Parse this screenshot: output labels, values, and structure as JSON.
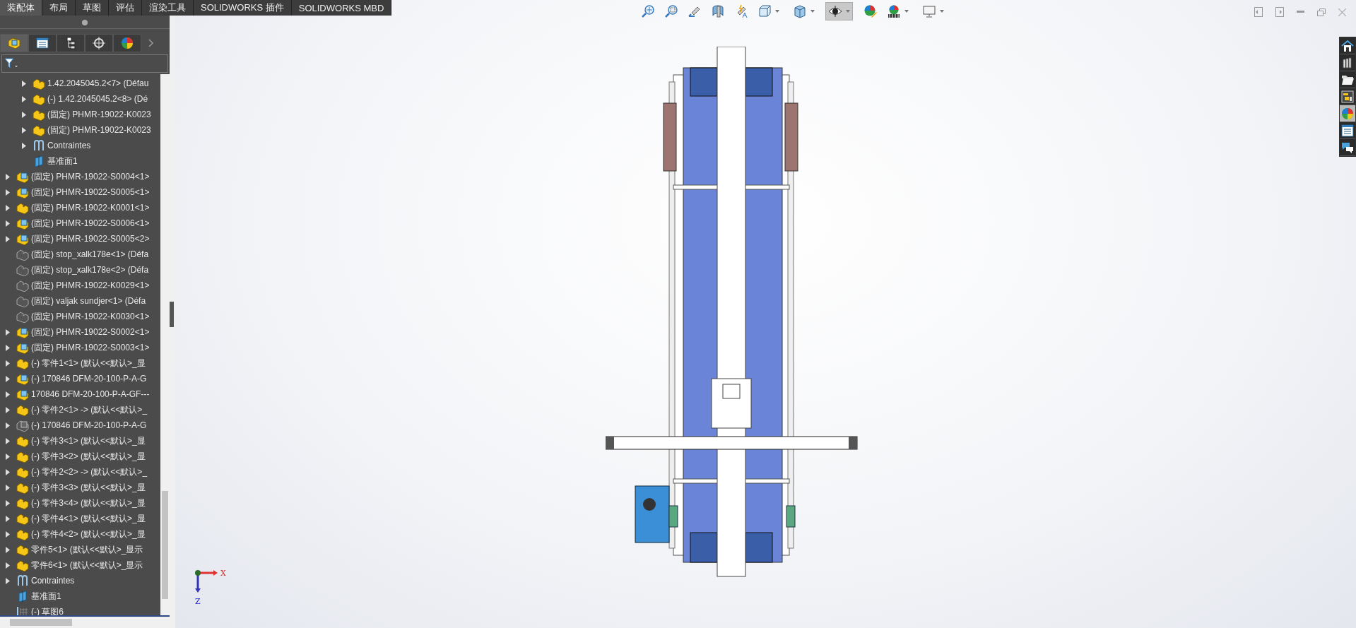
{
  "command_tabs": [
    {
      "label": "装配体",
      "selected": true
    },
    {
      "label": "布局",
      "selected": false
    },
    {
      "label": "草图",
      "selected": false
    },
    {
      "label": "评估",
      "selected": false
    },
    {
      "label": "渲染工具",
      "selected": false
    },
    {
      "label": "SOLIDWORKS 插件",
      "selected": false
    },
    {
      "label": "SOLIDWORKS MBD",
      "selected": false
    }
  ],
  "panel_tabs": [
    {
      "kind": "feature-tree",
      "selected": true
    },
    {
      "kind": "property",
      "selected": false
    },
    {
      "kind": "config",
      "selected": false
    },
    {
      "kind": "dimxpert",
      "selected": false
    },
    {
      "kind": "display",
      "selected": false
    }
  ],
  "tree": {
    "partial_children": [
      {
        "kind": "part",
        "label": "1.42.2045045.2<7> (Défau",
        "expandable": true
      },
      {
        "kind": "part",
        "label": "(-) 1.42.2045045.2<8> (Dé",
        "expandable": true
      },
      {
        "kind": "part",
        "label": "(固定) PHMR-19022-K0023",
        "expandable": true
      },
      {
        "kind": "part",
        "label": "(固定) PHMR-19022-K0023",
        "expandable": true
      },
      {
        "kind": "mates",
        "label": "Contraintes",
        "expandable": true
      },
      {
        "kind": "plane",
        "label": "基准面1",
        "expandable": false
      }
    ],
    "items": [
      {
        "kind": "assembly",
        "label": "(固定) PHMR-19022-S0004<1>",
        "expandable": true
      },
      {
        "kind": "assembly",
        "label": "(固定) PHMR-19022-S0005<1>",
        "expandable": true
      },
      {
        "kind": "part",
        "label": "(固定) PHMR-19022-K0001<1>",
        "expandable": true
      },
      {
        "kind": "assembly",
        "label": "(固定) PHMR-19022-S0006<1>",
        "expandable": true
      },
      {
        "kind": "assembly",
        "label": "(固定) PHMR-19022-S0005<2>",
        "expandable": true
      },
      {
        "kind": "suppressed-part",
        "label": "(固定) stop_xalk178e<1> (Défa",
        "expandable": false
      },
      {
        "kind": "suppressed-part",
        "label": "(固定) stop_xalk178e<2> (Défa",
        "expandable": false
      },
      {
        "kind": "suppressed-part",
        "label": "(固定) PHMR-19022-K0029<1>",
        "expandable": false
      },
      {
        "kind": "suppressed-part",
        "label": "(固定) valjak sundjer<1> (Défa",
        "expandable": false
      },
      {
        "kind": "suppressed-part",
        "label": "(固定) PHMR-19022-K0030<1>",
        "expandable": false
      },
      {
        "kind": "assembly",
        "label": "(固定) PHMR-19022-S0002<1>",
        "expandable": true
      },
      {
        "kind": "assembly",
        "label": "(固定) PHMR-19022-S0003<1>",
        "expandable": true
      },
      {
        "kind": "part",
        "label": "(-) 零件1<1> (默认<<默认>_显",
        "expandable": true
      },
      {
        "kind": "assembly",
        "label": "(-) 170846 DFM-20-100-P-A-G",
        "expandable": true
      },
      {
        "kind": "assembly",
        "label": "170846 DFM-20-100-P-A-GF---",
        "expandable": true
      },
      {
        "kind": "part",
        "label": "(-) 零件2<1> -> (默认<<默认>_",
        "expandable": true
      },
      {
        "kind": "suppressed-assembly",
        "label": "(-) 170846 DFM-20-100-P-A-G",
        "expandable": true
      },
      {
        "kind": "part",
        "label": "(-) 零件3<1> (默认<<默认>_显",
        "expandable": true
      },
      {
        "kind": "part",
        "label": "(-) 零件3<2> (默认<<默认>_显",
        "expandable": true
      },
      {
        "kind": "part",
        "label": "(-) 零件2<2> -> (默认<<默认>_",
        "expandable": true
      },
      {
        "kind": "part",
        "label": "(-) 零件3<3> (默认<<默认>_显",
        "expandable": true
      },
      {
        "kind": "part",
        "label": "(-) 零件3<4> (默认<<默认>_显",
        "expandable": true
      },
      {
        "kind": "part",
        "label": "(-) 零件4<1> (默认<<默认>_显",
        "expandable": true
      },
      {
        "kind": "part",
        "label": "(-) 零件4<2> (默认<<默认>_显",
        "expandable": true
      },
      {
        "kind": "part",
        "label": "零件5<1> (默认<<默认>_显示",
        "expandable": true
      },
      {
        "kind": "part",
        "label": "零件6<1> (默认<<默认>_显示",
        "expandable": true
      },
      {
        "kind": "mates",
        "label": "Contraintes",
        "expandable": true
      },
      {
        "kind": "plane",
        "label": "基准面1",
        "expandable": false
      },
      {
        "kind": "sketch",
        "label": "(-) 草图6",
        "expandable": false
      }
    ]
  },
  "view_toolbar": [
    {
      "kind": "zoom-fit",
      "selected": false,
      "dropdown": false
    },
    {
      "kind": "zoom-area",
      "selected": false,
      "dropdown": false
    },
    {
      "kind": "previous-view",
      "selected": false,
      "dropdown": false
    },
    {
      "kind": "section",
      "selected": false,
      "dropdown": false
    },
    {
      "kind": "dynamic-annotation",
      "selected": false,
      "dropdown": false
    },
    {
      "kind": "view-orientation",
      "selected": false,
      "dropdown": true
    },
    {
      "kind": "display-style",
      "selected": false,
      "dropdown": true
    },
    {
      "kind": "hide-show",
      "selected": true,
      "dropdown": true
    },
    {
      "kind": "edit-appearance",
      "selected": false,
      "dropdown": false
    },
    {
      "kind": "scenes",
      "selected": false,
      "dropdown": true
    },
    {
      "kind": "view-settings",
      "selected": false,
      "dropdown": true
    }
  ],
  "task_pane": [
    {
      "kind": "home",
      "selected": false
    },
    {
      "kind": "library",
      "selected": false
    },
    {
      "kind": "folder",
      "selected": false
    },
    {
      "kind": "palette",
      "selected": false
    },
    {
      "kind": "appearance",
      "selected": true
    },
    {
      "kind": "properties",
      "selected": false
    },
    {
      "kind": "forum",
      "selected": false
    }
  ],
  "triad": {
    "x_label": "X",
    "z_label": "Z"
  }
}
